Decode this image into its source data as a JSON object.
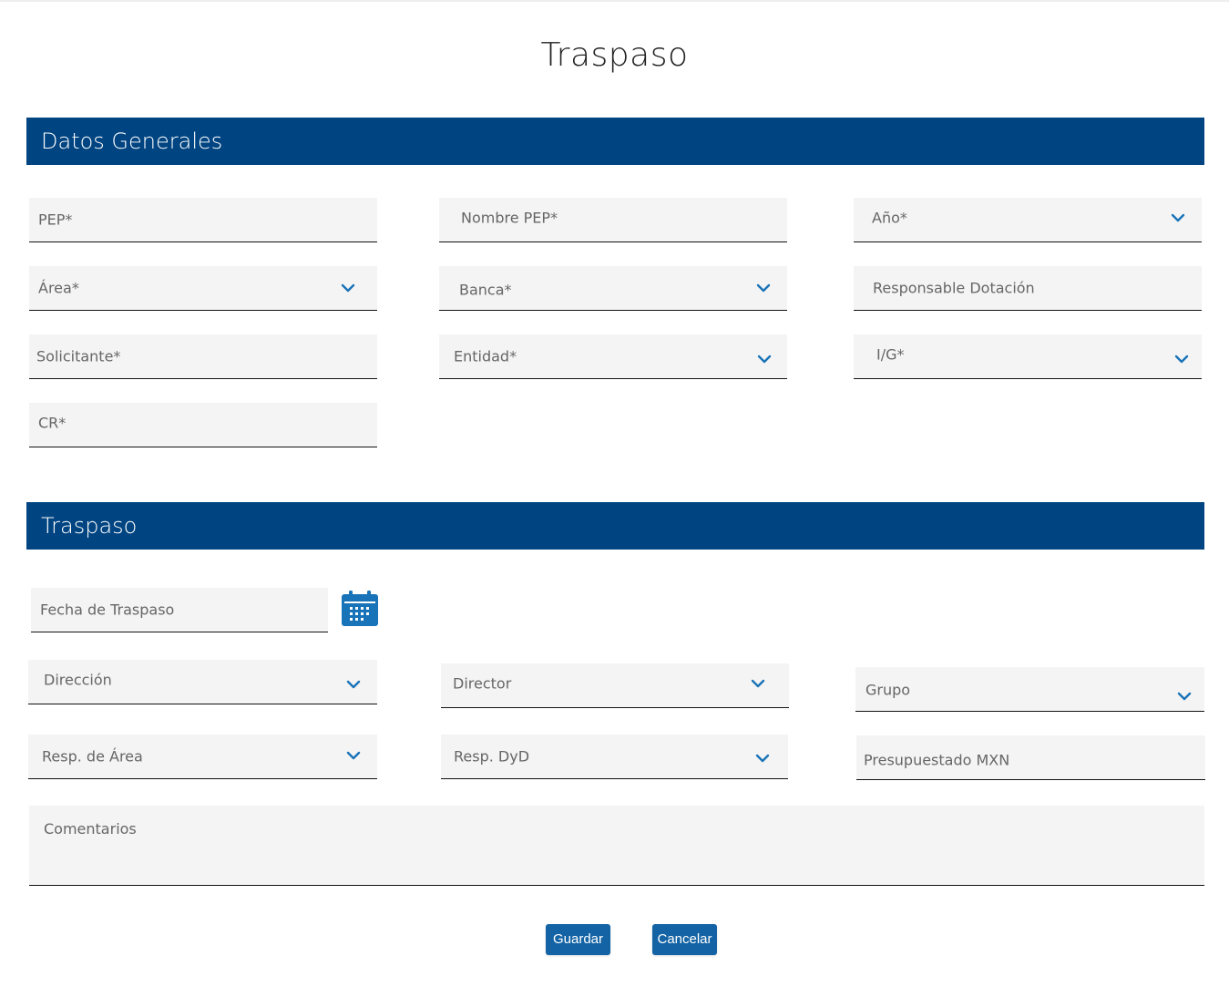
{
  "page": {
    "title": "Traspaso"
  },
  "sections": {
    "general": {
      "title": "Datos Generales"
    },
    "transfer": {
      "title": "Traspaso"
    }
  },
  "general_fields": {
    "pep": "PEP*",
    "nombre_pep": "Nombre PEP*",
    "anio": "Año*",
    "area": "Área*",
    "banca": "Banca*",
    "responsable_dotacion": "Responsable Dotación",
    "solicitante": "Solicitante*",
    "entidad": "Entidad*",
    "ig": "I/G*",
    "cr": "CR*"
  },
  "transfer_fields": {
    "fecha_traspaso": "Fecha de Traspaso",
    "direccion": "Dirección",
    "director": "Director",
    "grupo": "Grupo",
    "resp_area": "Resp. de Área",
    "resp_dyd": "Resp. DyD",
    "presupuestado_mxn": "Presupuestado MXN",
    "comentarios": "Comentarios"
  },
  "buttons": {
    "save": "Guardar",
    "cancel": "Cancelar"
  },
  "icons": {
    "dropdown": "chevron-down-icon",
    "calendar": "calendar-icon"
  },
  "colors": {
    "section_bar": "#004481",
    "accent": "#1973b8",
    "button": "#1464a5",
    "field_bg": "#f4f4f4"
  }
}
